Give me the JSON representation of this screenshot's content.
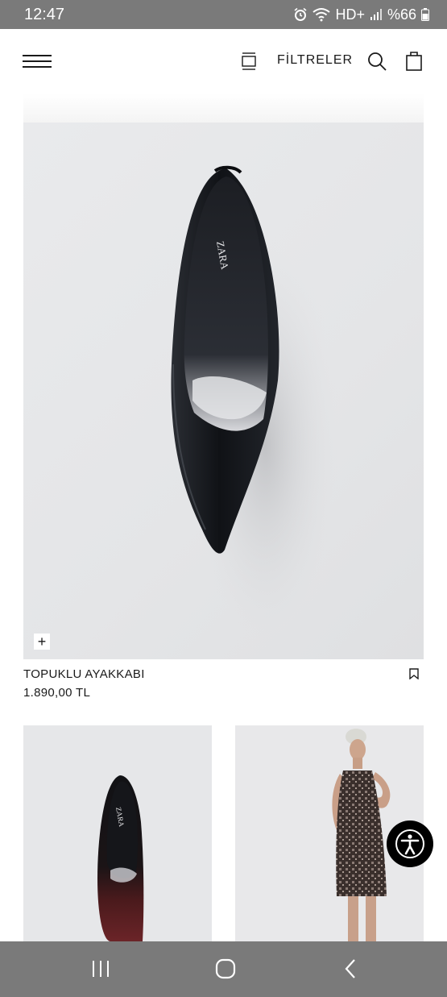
{
  "status_bar": {
    "time": "12:47",
    "network": "HD+",
    "battery": "%66",
    "icons": [
      "alarm-icon",
      "wifi-icon",
      "signal-icon",
      "battery-icon"
    ]
  },
  "header": {
    "icons": [
      "menu-icon",
      "grid-view-icon",
      "search-icon",
      "shopping-bag-icon"
    ],
    "filters_label": "FİLTRELER"
  },
  "product": {
    "name": "TOPUKLU AYAKKABI",
    "price": "1.890,00 TL",
    "brand_mark": "ZARA",
    "add_label": "+"
  },
  "grid": [
    {
      "image": "burgundy-black-pump",
      "brand_mark": "ZARA"
    },
    {
      "image": "model-in-sequin-dress"
    }
  ],
  "colors": {
    "status_bar": "#7a7a7a",
    "nav_bar": "#7a7a7a",
    "accessibility_button": "#000000",
    "text": "#1a1a1a"
  },
  "nav_bar": {
    "icons": [
      "recent-apps-icon",
      "home-icon",
      "back-icon"
    ]
  }
}
